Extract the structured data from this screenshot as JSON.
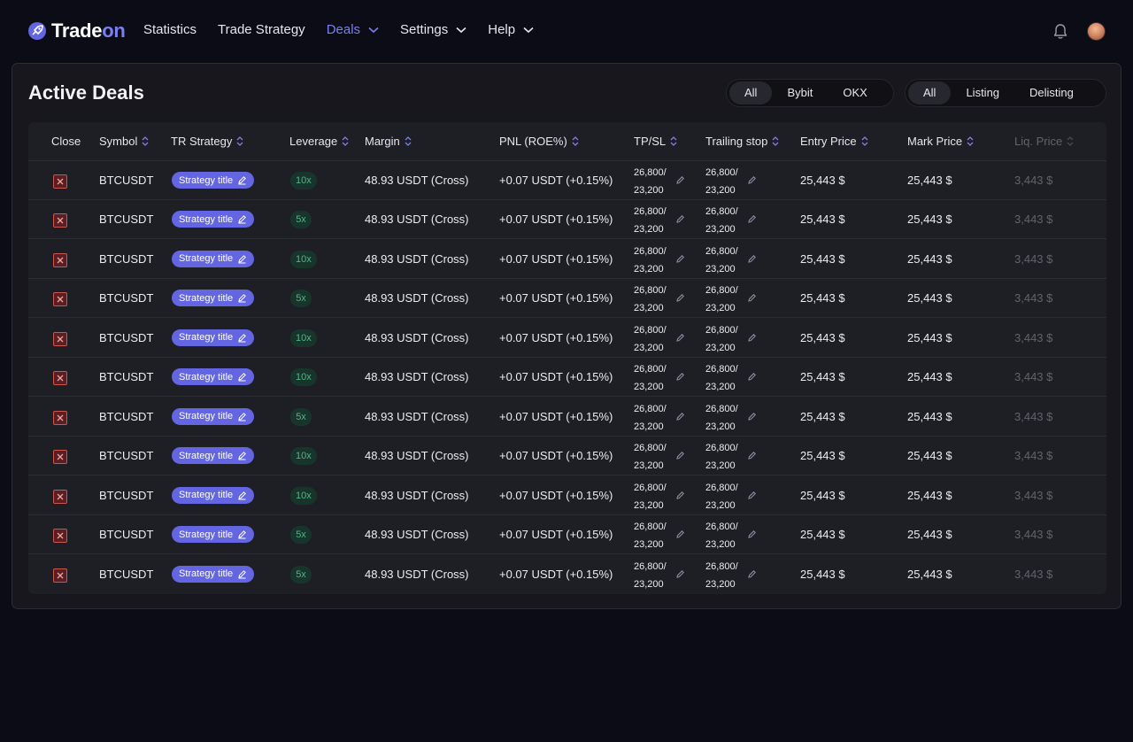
{
  "brand": {
    "name_main": "Trade",
    "name_accent": "on"
  },
  "nav": [
    {
      "label": "Statistics",
      "active": false,
      "dropdown": false
    },
    {
      "label": "Trade Strategy",
      "active": false,
      "dropdown": false
    },
    {
      "label": "Deals",
      "active": true,
      "dropdown": true
    },
    {
      "label": "Settings",
      "active": false,
      "dropdown": true
    },
    {
      "label": "Help",
      "active": false,
      "dropdown": true
    }
  ],
  "page_title": "Active Deals",
  "filters": {
    "exchange": {
      "options": [
        "All",
        "Bybit",
        "OKX"
      ],
      "selected": "All"
    },
    "type": {
      "options": [
        "All",
        "Listing",
        "Delisting"
      ],
      "selected": "All"
    }
  },
  "table": {
    "columns": [
      "Close",
      "Symbol",
      "TR Strategy",
      "Leverage",
      "Margin",
      "PNL (ROE%)",
      "TP/SL",
      "Trailing stop",
      "Entry Price",
      "Mark Price",
      "Liq. Price"
    ],
    "rows": [
      {
        "symbol": "BTCUSDT",
        "strategy": "Strategy title",
        "leverage": "10x",
        "margin": "48.93 USDT (Cross)",
        "pnl": "+0.07 USDT (+0.15%)",
        "tp": "26,800/",
        "sl": "23,200",
        "trail_top": "26,800/",
        "trail_bottom": "23,200",
        "entry": "25,443 $",
        "mark": "25,443 $",
        "liq": "3,443 $"
      },
      {
        "symbol": "BTCUSDT",
        "strategy": "Strategy title",
        "leverage": "5x",
        "margin": "48.93 USDT (Cross)",
        "pnl": "+0.07 USDT (+0.15%)",
        "tp": "26,800/",
        "sl": "23,200",
        "trail_top": "26,800/",
        "trail_bottom": "23,200",
        "entry": "25,443 $",
        "mark": "25,443 $",
        "liq": "3,443 $"
      },
      {
        "symbol": "BTCUSDT",
        "strategy": "Strategy title",
        "leverage": "10x",
        "margin": "48.93 USDT (Cross)",
        "pnl": "+0.07 USDT (+0.15%)",
        "tp": "26,800/",
        "sl": "23,200",
        "trail_top": "26,800/",
        "trail_bottom": "23,200",
        "entry": "25,443 $",
        "mark": "25,443 $",
        "liq": "3,443 $"
      },
      {
        "symbol": "BTCUSDT",
        "strategy": "Strategy title",
        "leverage": "5x",
        "margin": "48.93 USDT (Cross)",
        "pnl": "+0.07 USDT (+0.15%)",
        "tp": "26,800/",
        "sl": "23,200",
        "trail_top": "26,800/",
        "trail_bottom": "23,200",
        "entry": "25,443 $",
        "mark": "25,443 $",
        "liq": "3,443 $"
      },
      {
        "symbol": "BTCUSDT",
        "strategy": "Strategy title",
        "leverage": "10x",
        "margin": "48.93 USDT (Cross)",
        "pnl": "+0.07 USDT (+0.15%)",
        "tp": "26,800/",
        "sl": "23,200",
        "trail_top": "26,800/",
        "trail_bottom": "23,200",
        "entry": "25,443 $",
        "mark": "25,443 $",
        "liq": "3,443 $"
      },
      {
        "symbol": "BTCUSDT",
        "strategy": "Strategy title",
        "leverage": "10x",
        "margin": "48.93 USDT (Cross)",
        "pnl": "+0.07 USDT (+0.15%)",
        "tp": "26,800/",
        "sl": "23,200",
        "trail_top": "26,800/",
        "trail_bottom": "23,200",
        "entry": "25,443 $",
        "mark": "25,443 $",
        "liq": "3,443 $"
      },
      {
        "symbol": "BTCUSDT",
        "strategy": "Strategy title",
        "leverage": "5x",
        "margin": "48.93 USDT (Cross)",
        "pnl": "+0.07 USDT (+0.15%)",
        "tp": "26,800/",
        "sl": "23,200",
        "trail_top": "26,800/",
        "trail_bottom": "23,200",
        "entry": "25,443 $",
        "mark": "25,443 $",
        "liq": "3,443 $"
      },
      {
        "symbol": "BTCUSDT",
        "strategy": "Strategy title",
        "leverage": "10x",
        "margin": "48.93 USDT (Cross)",
        "pnl": "+0.07 USDT (+0.15%)",
        "tp": "26,800/",
        "sl": "23,200",
        "trail_top": "26,800/",
        "trail_bottom": "23,200",
        "entry": "25,443 $",
        "mark": "25,443 $",
        "liq": "3,443 $"
      },
      {
        "symbol": "BTCUSDT",
        "strategy": "Strategy title",
        "leverage": "10x",
        "margin": "48.93 USDT (Cross)",
        "pnl": "+0.07 USDT (+0.15%)",
        "tp": "26,800/",
        "sl": "23,200",
        "trail_top": "26,800/",
        "trail_bottom": "23,200",
        "entry": "25,443 $",
        "mark": "25,443 $",
        "liq": "3,443 $"
      },
      {
        "symbol": "BTCUSDT",
        "strategy": "Strategy title",
        "leverage": "5x",
        "margin": "48.93 USDT (Cross)",
        "pnl": "+0.07 USDT (+0.15%)",
        "tp": "26,800/",
        "sl": "23,200",
        "trail_top": "26,800/",
        "trail_bottom": "23,200",
        "entry": "25,443 $",
        "mark": "25,443 $",
        "liq": "3,443 $"
      },
      {
        "symbol": "BTCUSDT",
        "strategy": "Strategy title",
        "leverage": "5x",
        "margin": "48.93 USDT (Cross)",
        "pnl": "+0.07 USDT (+0.15%)",
        "tp": "26,800/",
        "sl": "23,200",
        "trail_top": "26,800/",
        "trail_bottom": "23,200",
        "entry": "25,443 $",
        "mark": "25,443 $",
        "liq": "3,443 $"
      }
    ]
  },
  "colors": {
    "accent": "#7b7ff0",
    "strategy_pill": "#6366e0",
    "leverage_text": "#4fb589",
    "close_border": "#c9574f"
  },
  "icons": {
    "logo": "rocket-logo-icon",
    "bell": "bell-icon",
    "sort": "sort-arrows-icon",
    "edit": "pencil-icon",
    "close": "close-x-icon",
    "chevron": "chevron-down-icon"
  }
}
